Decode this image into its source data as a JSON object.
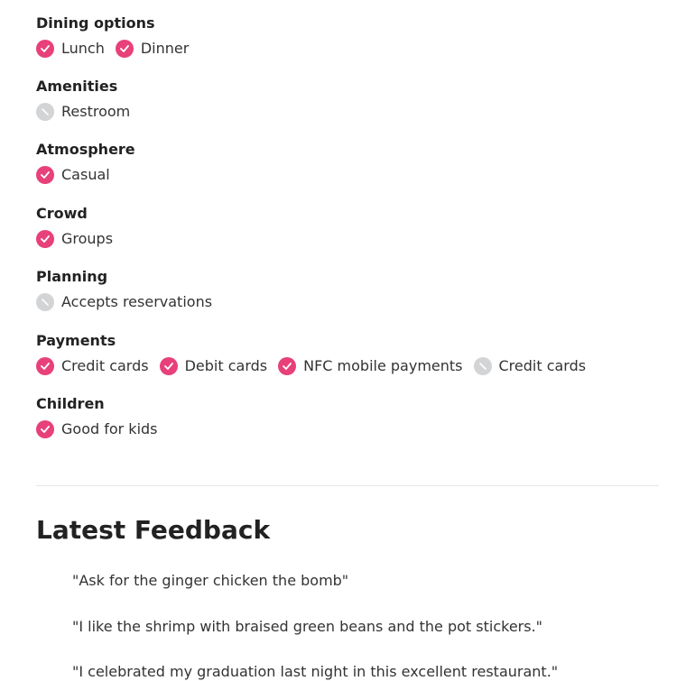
{
  "sections": [
    {
      "title": "Dining options",
      "items": [
        {
          "label": "Lunch",
          "available": true
        },
        {
          "label": "Dinner",
          "available": true
        }
      ]
    },
    {
      "title": "Amenities",
      "items": [
        {
          "label": "Restroom",
          "available": false
        }
      ]
    },
    {
      "title": "Atmosphere",
      "items": [
        {
          "label": "Casual",
          "available": true
        }
      ]
    },
    {
      "title": "Crowd",
      "items": [
        {
          "label": "Groups",
          "available": true
        }
      ]
    },
    {
      "title": "Planning",
      "items": [
        {
          "label": "Accepts reservations",
          "available": false
        }
      ]
    },
    {
      "title": "Payments",
      "items": [
        {
          "label": "Credit cards",
          "available": true
        },
        {
          "label": "Debit cards",
          "available": true
        },
        {
          "label": "NFC mobile payments",
          "available": true
        },
        {
          "label": "Credit cards",
          "available": false
        }
      ]
    },
    {
      "title": "Children",
      "items": [
        {
          "label": "Good for kids",
          "available": true
        }
      ]
    }
  ],
  "feedback": {
    "title": "Latest Feedback",
    "quotes": [
      "\"Ask for the ginger chicken the bomb\"",
      "\"I like the shrimp with braised green beans and the pot stickers.\"",
      "\"I celebrated my graduation last night in this excellent restaurant.\""
    ]
  },
  "icons": {
    "available": "check-icon",
    "unavailable": "slash-icon"
  },
  "colors": {
    "available": "#e8407a",
    "unavailable": "#d2d4d6",
    "text": "#222222"
  }
}
